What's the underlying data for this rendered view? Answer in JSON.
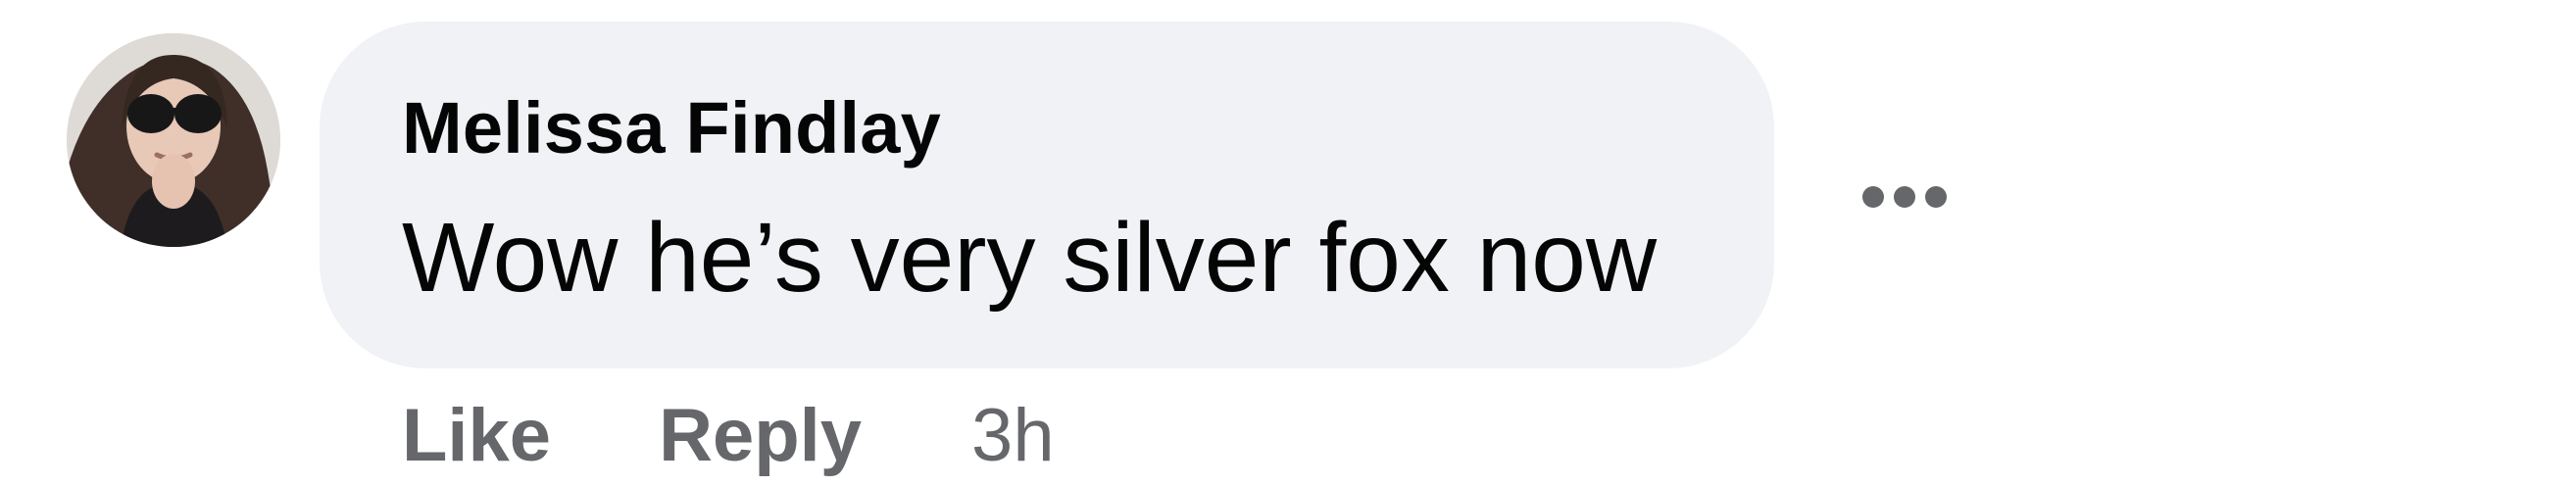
{
  "comment": {
    "author": "Melissa Findlay",
    "text": "Wow he’s very silver fox now",
    "avatar_icon": "profile-photo",
    "more_icon": "more-options-icon"
  },
  "actions": {
    "like_label": "Like",
    "reply_label": "Reply",
    "timestamp": "3h"
  },
  "colors": {
    "bubble": "#f0f2f5",
    "primary_text": "#050505",
    "secondary_text": "#65676b"
  }
}
